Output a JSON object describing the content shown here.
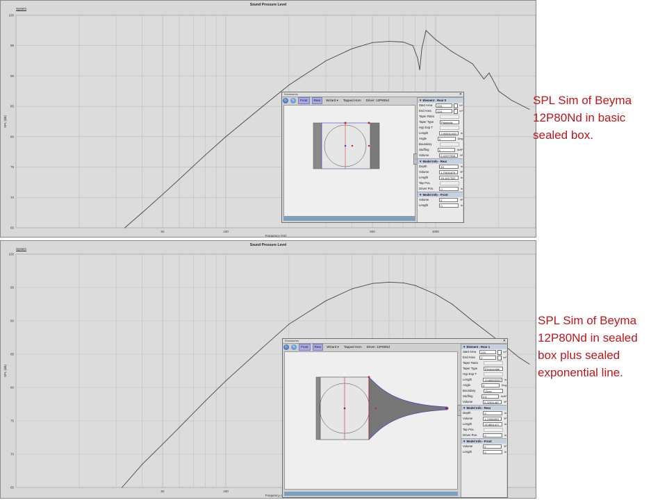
{
  "colors": {
    "accent_red": "#c0141b",
    "curve": "#444444",
    "grid": "#b8b8b8",
    "panel_bg": "#d8d8d8"
  },
  "panel1": {
    "tab": "System",
    "chart_data": {
      "type": "line",
      "title": "Sound Pressure Level",
      "xlabel": "Frequency (Hz)",
      "ylabel": "SPL (dB)",
      "xscale": "log",
      "xlim": [
        10,
        3000
      ],
      "ylim": [
        65,
        100
      ],
      "x_tick_labels": [
        "50",
        "100",
        "500",
        "1000"
      ],
      "y_tick_labels": [
        "100",
        "95",
        "90",
        "85",
        "80",
        "75",
        "70",
        "65"
      ],
      "grid": true,
      "series": [
        {
          "x": [
            33,
            40,
            50,
            60,
            80,
            100,
            150,
            200,
            300,
            400,
            500,
            600,
            700,
            780,
            820,
            840,
            860,
            900,
            1000,
            1200,
            1500,
            1700,
            1800,
            1900,
            2000,
            2300,
            2800
          ],
          "y": [
            65,
            67.5,
            70.5,
            73,
            77,
            80,
            85,
            88.5,
            92.5,
            94.5,
            95.5,
            95.7,
            95.6,
            95,
            93,
            91,
            94.5,
            97.5,
            96,
            94,
            92,
            89.5,
            90.5,
            89,
            87.5,
            86,
            84.5
          ]
        }
      ]
    }
  },
  "panel2": {
    "tab": "System",
    "chart_data": {
      "type": "line",
      "title": "Sound Pressure Level",
      "xlabel": "Frequency (Hz)",
      "ylabel": "SPL (dB)",
      "xscale": "log",
      "xlim": [
        10,
        3000
      ],
      "ylim": [
        65,
        100
      ],
      "x_tick_labels": [
        "50",
        "100",
        "500",
        "1000"
      ],
      "y_tick_labels": [
        "100",
        "95",
        "90",
        "85",
        "80",
        "75",
        "70",
        "65"
      ],
      "grid": true,
      "series": [
        {
          "x": [
            32,
            40,
            50,
            60,
            80,
            100,
            150,
            200,
            300,
            400,
            500,
            600,
            700,
            800,
            1000,
            1200,
            1500,
            2000,
            2500,
            2800
          ],
          "y": [
            65,
            68.5,
            71.5,
            74,
            78,
            81,
            86,
            89.5,
            93,
            94.8,
            95.6,
            95.8,
            95.7,
            95.3,
            94,
            92.5,
            90,
            87,
            84.5,
            83.5
          ]
        }
      ]
    }
  },
  "captions": {
    "top": "SPL Sim of Beyma\n12P80Nd in basic\nsealed box.",
    "bottom": "SPL Sim of Beyma\n12P80Nd in sealed\nbox plus sealed\nexponential line."
  },
  "hornbox1": {
    "window_title": "Enclosures",
    "toolbar": {
      "front": "Front",
      "rear": "Rear",
      "wizard": "Wizard",
      "tapped_horn": "Tapped Horn",
      "driver": "Driver: 12P80Nd"
    },
    "element_header": "Element : Rear 0",
    "rows": [
      {
        "label": "Start Area",
        "value": "124",
        "unit": "in²"
      },
      {
        "label": "End Area",
        "value": "124",
        "unit": "in²"
      },
      {
        "label": "Taper Ratio",
        "value": "",
        "unit": ""
      },
      {
        "label": "Taper Type",
        "value": "Parabolic",
        "unit": ""
      },
      {
        "label": "Hyp Exp T",
        "value": "",
        "unit": ""
      },
      {
        "label": "Length",
        "value": "3.905511811",
        "unit": "in"
      },
      {
        "label": "Angle",
        "value": "0",
        "unit": "Deg"
      },
      {
        "label": "Boundary",
        "value": "",
        "unit": ""
      },
      {
        "label": "Stuffing",
        "value": "0",
        "unit": "lb/ft³"
      },
      {
        "label": "Volume",
        "value": "0.42377518",
        "unit": "ft³"
      }
    ],
    "rear_header": "Model Info - Rear",
    "rear_rows": [
      {
        "label": "Depth",
        "value": "10",
        "unit": "in"
      },
      {
        "label": "Volume",
        "value": "1.70031875",
        "unit": "ft³"
      },
      {
        "label": "Length",
        "value": "16.1417322",
        "unit": "in"
      },
      {
        "label": "Tap Pos.",
        "value": "",
        "unit": ""
      },
      {
        "label": "Driver Pos.",
        "value": "0",
        "unit": "in"
      }
    ],
    "front_header": "Model Info - Front",
    "front_rows": [
      {
        "label": "Volume",
        "value": "0",
        "unit": "ft³"
      },
      {
        "label": "Length",
        "value": "0",
        "unit": "in"
      }
    ]
  },
  "hornbox2": {
    "window_title": "Enclosures",
    "toolbar": {
      "front": "Front",
      "rear": "Rear",
      "wizard": "Wizard",
      "tapped_horn": "Tapped Horn",
      "driver": "Driver: 12P80Nd"
    },
    "element_header": "Element : Rear 1",
    "rows": [
      {
        "label": "Start Area",
        "value": "120",
        "unit": "in²"
      },
      {
        "label": "End Area",
        "value": "2",
        "unit": "in²"
      },
      {
        "label": "Taper Ratio",
        "value": "",
        "unit": ""
      },
      {
        "label": "Taper Type",
        "value": "Exponential",
        "unit": ""
      },
      {
        "label": "Hyp Exp T",
        "value": "",
        "unit": ""
      },
      {
        "label": "Length",
        "value": "19.68503937",
        "unit": "in"
      },
      {
        "label": "Angle",
        "value": "0",
        "unit": "Deg"
      },
      {
        "label": "Boundary",
        "value": "Open",
        "unit": ""
      },
      {
        "label": "Stuffing",
        "value": "0.5",
        "unit": "lb/ft³"
      },
      {
        "label": "Volume",
        "value": "0.32531487",
        "unit": "ft³"
      }
    ],
    "rear_header": "Model Info - Rear",
    "rear_rows": [
      {
        "label": "Depth",
        "value": "9",
        "unit": "in"
      },
      {
        "label": "Volume",
        "value": "1.24366891",
        "unit": "ft³"
      },
      {
        "label": "Length",
        "value": "32.8661417",
        "unit": "in"
      },
      {
        "label": "Tap Pos.",
        "value": "",
        "unit": ""
      },
      {
        "label": "Driver Pos.",
        "value": "0",
        "unit": "in"
      }
    ],
    "front_header": "Model Info - Front",
    "front_rows": [
      {
        "label": "Volume",
        "value": "0",
        "unit": "ft³"
      },
      {
        "label": "Length",
        "value": "0",
        "unit": "in"
      }
    ]
  }
}
